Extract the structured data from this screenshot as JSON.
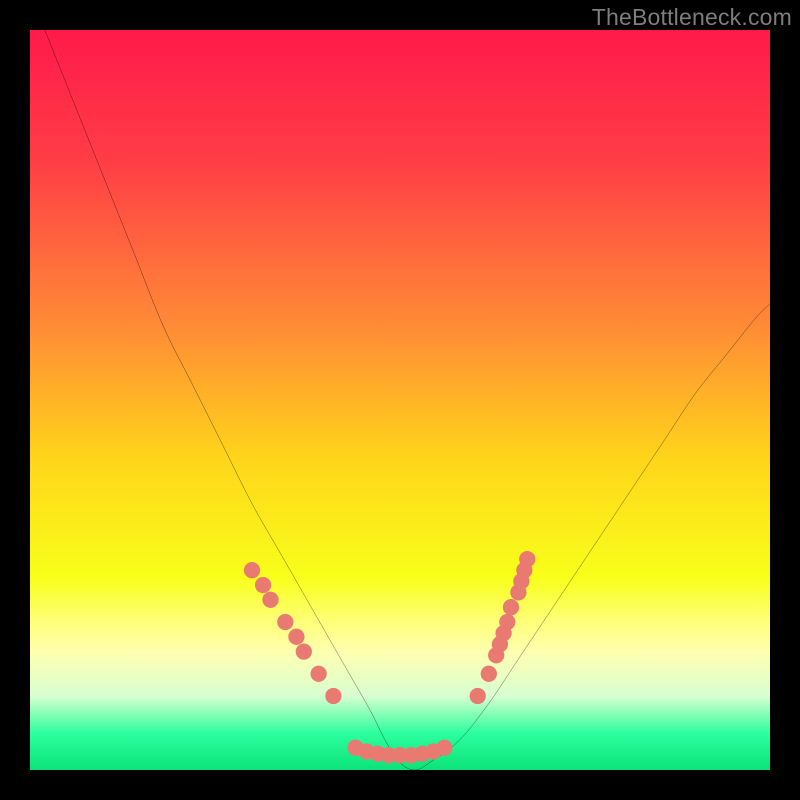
{
  "watermark": "TheBottleneck.com",
  "chart_data": {
    "type": "line",
    "title": "",
    "xlabel": "",
    "ylabel": "",
    "xlim": [
      0,
      100
    ],
    "ylim": [
      0,
      100
    ],
    "gradient_stops": [
      {
        "offset": 0,
        "color": "#ff1a4b"
      },
      {
        "offset": 18,
        "color": "#ff3e46"
      },
      {
        "offset": 40,
        "color": "#ff8b36"
      },
      {
        "offset": 58,
        "color": "#ffd51a"
      },
      {
        "offset": 74,
        "color": "#f8ff1a"
      },
      {
        "offset": 80,
        "color": "#ffff7a"
      },
      {
        "offset": 84,
        "color": "#ffffb0"
      },
      {
        "offset": 90,
        "color": "#d8ffd0"
      },
      {
        "offset": 95,
        "color": "#2dff9e"
      },
      {
        "offset": 100,
        "color": "#0be37a"
      }
    ],
    "series": [
      {
        "name": "bottleneck-curve",
        "color": "#000000",
        "x": [
          2,
          6,
          10,
          14,
          18,
          22,
          26,
          30,
          34,
          38,
          42,
          46,
          48,
          50,
          52,
          54,
          58,
          62,
          66,
          70,
          74,
          78,
          82,
          86,
          90,
          94,
          98,
          100
        ],
        "y": [
          100,
          90,
          80,
          70,
          60,
          52,
          44,
          36,
          29,
          22,
          15,
          8,
          4,
          1,
          0,
          1,
          4,
          9,
          15,
          21,
          27,
          33,
          39,
          45,
          51,
          56,
          61,
          63
        ]
      }
    ],
    "markers": {
      "color": "#e97a72",
      "radius": 1.1,
      "points": [
        {
          "x": 30.0,
          "y": 27.0
        },
        {
          "x": 31.5,
          "y": 25.0
        },
        {
          "x": 32.5,
          "y": 23.0
        },
        {
          "x": 34.5,
          "y": 20.0
        },
        {
          "x": 36.0,
          "y": 18.0
        },
        {
          "x": 37.0,
          "y": 16.0
        },
        {
          "x": 39.0,
          "y": 13.0
        },
        {
          "x": 41.0,
          "y": 10.0
        },
        {
          "x": 44.0,
          "y": 3.0
        },
        {
          "x": 45.5,
          "y": 2.5
        },
        {
          "x": 47.0,
          "y": 2.2
        },
        {
          "x": 48.5,
          "y": 2.0
        },
        {
          "x": 50.0,
          "y": 2.0
        },
        {
          "x": 51.5,
          "y": 2.0
        },
        {
          "x": 53.0,
          "y": 2.2
        },
        {
          "x": 54.5,
          "y": 2.5
        },
        {
          "x": 56.0,
          "y": 3.0
        },
        {
          "x": 60.5,
          "y": 10.0
        },
        {
          "x": 62.0,
          "y": 13.0
        },
        {
          "x": 63.0,
          "y": 15.5
        },
        {
          "x": 63.5,
          "y": 17.0
        },
        {
          "x": 64.0,
          "y": 18.5
        },
        {
          "x": 64.5,
          "y": 20.0
        },
        {
          "x": 65.0,
          "y": 22.0
        },
        {
          "x": 66.0,
          "y": 24.0
        },
        {
          "x": 66.4,
          "y": 25.5
        },
        {
          "x": 66.8,
          "y": 27.0
        },
        {
          "x": 67.2,
          "y": 28.5
        }
      ]
    }
  }
}
